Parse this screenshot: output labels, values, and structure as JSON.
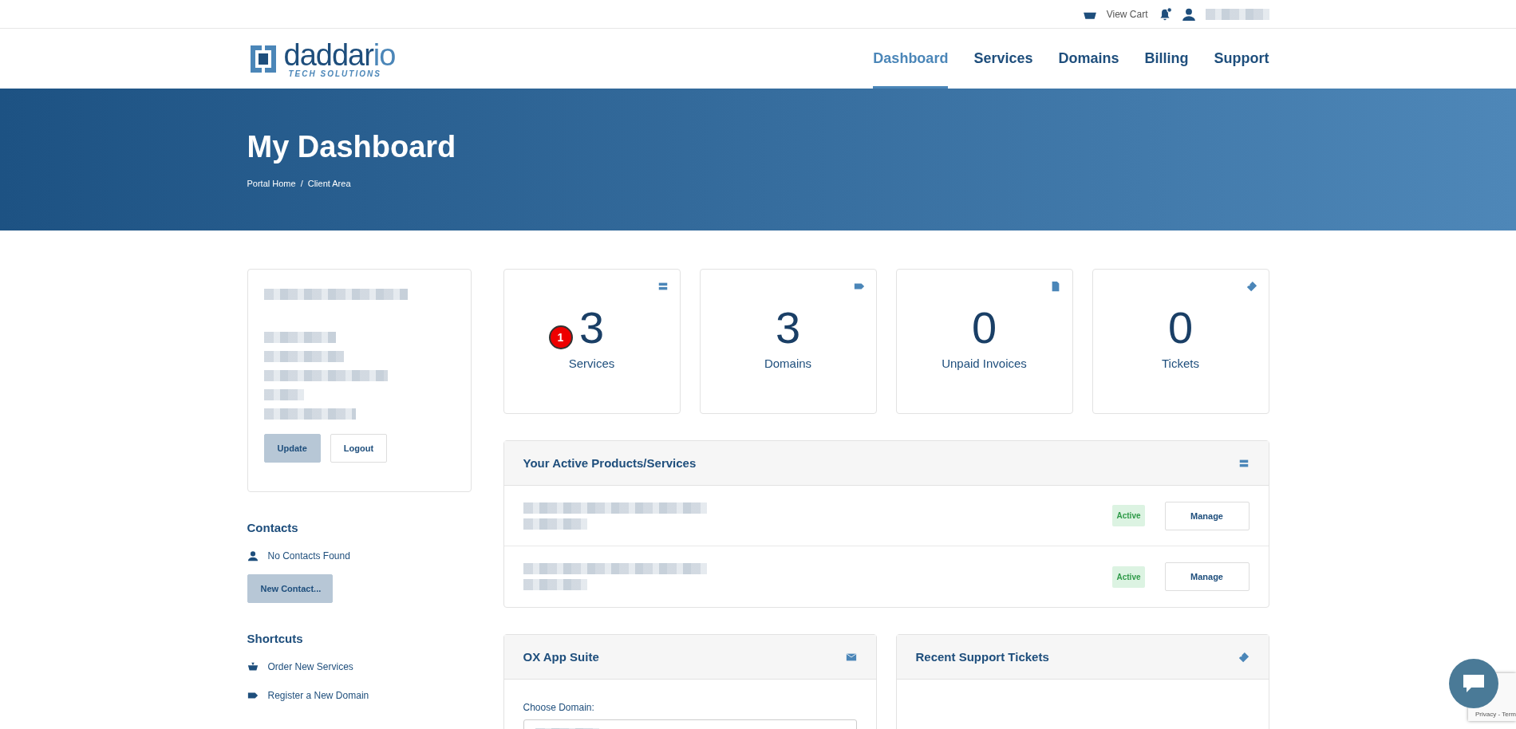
{
  "topbar": {
    "cart": "View Cart",
    "notifications_unread": true
  },
  "brand": {
    "name_primary": "daddar",
    "name_accent": "io",
    "tagline": "TECH SOLUTIONS"
  },
  "nav": [
    {
      "label": "Dashboard",
      "selected": true
    },
    {
      "label": "Services",
      "selected": false
    },
    {
      "label": "Domains",
      "selected": false
    },
    {
      "label": "Billing",
      "selected": false
    },
    {
      "label": "Support",
      "selected": false
    }
  ],
  "hero": {
    "title": "My Dashboard",
    "breadcrumb": [
      "Portal Home",
      "Client Area"
    ],
    "separator": "/"
  },
  "profile": {
    "buttons": [
      {
        "label": "Update",
        "kind": "primary"
      },
      {
        "label": "Logout",
        "kind": "outline"
      }
    ]
  },
  "contacts": {
    "title": "Contacts",
    "empty": "No Contacts Found",
    "button": "New Contact..."
  },
  "shortcuts": {
    "title": "Shortcuts",
    "items": [
      {
        "label": "Order New Services",
        "kind": "basket"
      },
      {
        "label": "Register a New Domain",
        "kind": "tag"
      }
    ]
  },
  "stats": [
    {
      "value": "3",
      "label": "Services",
      "kind": "server",
      "marker": "1"
    },
    {
      "value": "3",
      "label": "Domains",
      "kind": "tag"
    },
    {
      "value": "0",
      "label": "Unpaid Invoices",
      "kind": "file"
    },
    {
      "value": "0",
      "label": "Tickets",
      "kind": "ticket"
    }
  ],
  "products": {
    "title": "Your Active Products/Services",
    "rows": [
      {
        "status": "Active",
        "action": "Manage"
      },
      {
        "status": "Active",
        "action": "Manage"
      }
    ]
  },
  "ox": {
    "title": "OX App Suite",
    "field_label": "Choose Domain:"
  },
  "tickets": {
    "title": "Recent Support Tickets"
  },
  "recaptcha": "Privacy - Term"
}
